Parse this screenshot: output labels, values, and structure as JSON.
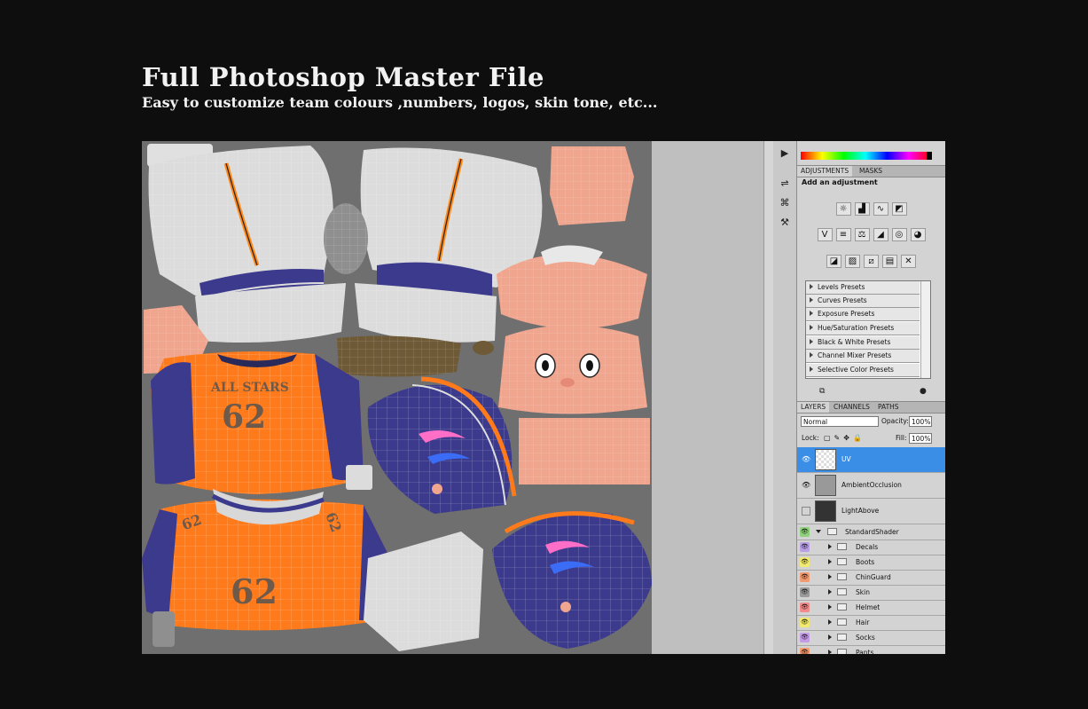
{
  "header": {
    "title": "Full Photoshop Master File",
    "subtitle": "Easy to customize team colours ,numbers, logos, skin tone, etc..."
  },
  "texture": {
    "jersey_text": "ALL STARS",
    "jersey_number": "62",
    "colors": {
      "orange": "#ff7a1a",
      "navy": "#3c3a8c",
      "white": "#e8e8e8",
      "skin": "#f0a58e",
      "bg": "#6f6f6f"
    }
  },
  "adjustments": {
    "tabs": [
      "ADJUSTMENTS",
      "MASKS"
    ],
    "title": "Add an adjustment",
    "row1_icons": [
      "brightness-icon",
      "levels-icon",
      "curves-icon",
      "exposure-icon"
    ],
    "row2_icons": [
      "vibrance-icon",
      "hue-saturation-icon",
      "color-balance-icon",
      "black-white-icon",
      "photo-filter-icon",
      "channel-mixer-icon"
    ],
    "row3_icons": [
      "invert-icon",
      "posterize-icon",
      "threshold-icon",
      "gradient-map-icon",
      "selective-color-icon"
    ],
    "presets": [
      "Levels Presets",
      "Curves Presets",
      "Exposure Presets",
      "Hue/Saturation Presets",
      "Black & White Presets",
      "Channel Mixer Presets",
      "Selective Color Presets"
    ]
  },
  "layers_panel": {
    "tabs": [
      "LAYERS",
      "CHANNELS",
      "PATHS"
    ],
    "blend_mode": "Normal",
    "opacity_label": "Opacity:",
    "opacity_value": "100%",
    "lock_label": "Lock:",
    "fill_label": "Fill:",
    "fill_value": "100%",
    "layers": [
      {
        "name": "UV",
        "selected": true,
        "visible": true
      },
      {
        "name": "AmbientOcclusion",
        "selected": false,
        "visible": true
      },
      {
        "name": "LightAbove",
        "selected": false,
        "visible": false
      }
    ],
    "group": {
      "name": "StandardShader",
      "color": "#8fd07a"
    },
    "subgroups": [
      {
        "name": "Decals",
        "color": "#b9a0e6"
      },
      {
        "name": "Boots",
        "color": "#f2ea6e"
      },
      {
        "name": "ChinGuard",
        "color": "#f29a6e"
      },
      {
        "name": "Skin",
        "color": "#9a9a9a"
      },
      {
        "name": "Helmet",
        "color": "#f28a8a"
      },
      {
        "name": "Hair",
        "color": "#f2ea6e"
      },
      {
        "name": "Socks",
        "color": "#c59ae6"
      },
      {
        "name": "Pants",
        "color": "#f29a6e"
      }
    ]
  }
}
